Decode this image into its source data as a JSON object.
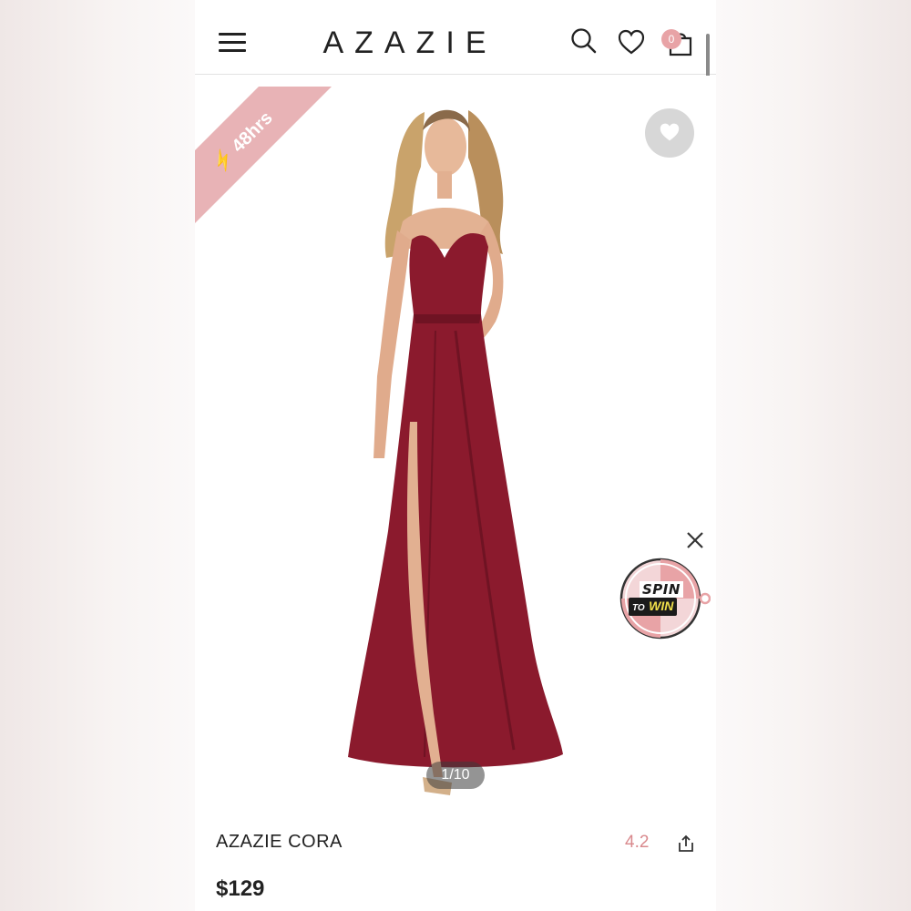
{
  "header": {
    "logo": "AZAZIE",
    "cart_count": "0"
  },
  "banner": {
    "label": "48hrs"
  },
  "gallery": {
    "counter": "1/10"
  },
  "spin_widget": {
    "line1": "SPIN",
    "line2_a": "TO",
    "line2_b": "WIN"
  },
  "product": {
    "name": "AZAZIE CORA",
    "rating": "4.2",
    "price": "$129"
  },
  "colors": {
    "accent_pink": "#e8b3b6",
    "badge_pink": "#e8a3a6",
    "rating_pink": "#d9898d",
    "dress_burgundy": "#8b1a2d"
  },
  "icons": [
    "menu-icon",
    "search-icon",
    "heart-icon",
    "cart-icon",
    "lightning-icon",
    "share-icon",
    "close-icon"
  ]
}
